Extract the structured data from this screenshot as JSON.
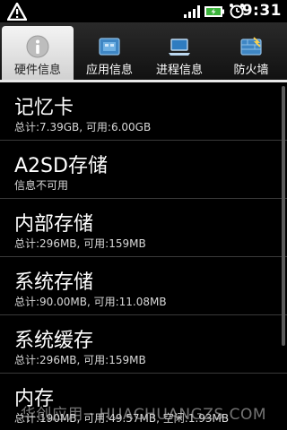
{
  "statusbar": {
    "time": "9:31"
  },
  "tabs": [
    {
      "label": "硬件信息",
      "icon": "info-icon",
      "active": true
    },
    {
      "label": "应用信息",
      "icon": "apps-icon",
      "active": false
    },
    {
      "label": "进程信息",
      "icon": "laptop-icon",
      "active": false
    },
    {
      "label": "防火墙",
      "icon": "firewall-icon",
      "active": false
    }
  ],
  "items": [
    {
      "title": "记忆卡",
      "sub": "总计:7.39GB, 可用:6.00GB"
    },
    {
      "title": "A2SD存储",
      "sub": "信息不可用"
    },
    {
      "title": "内部存储",
      "sub": "总计:296MB, 可用:159MB"
    },
    {
      "title": "系统存储",
      "sub": "总计:90.00MB, 可用:11.08MB"
    },
    {
      "title": "系统缓存",
      "sub": "总计:296MB, 可用:159MB"
    },
    {
      "title": "内存",
      "sub": "总计:190MB, 可用:49.57MB, 空闲:1.93MB"
    }
  ],
  "watermark": "华创应用 · HUACHUANGZS.COM"
}
